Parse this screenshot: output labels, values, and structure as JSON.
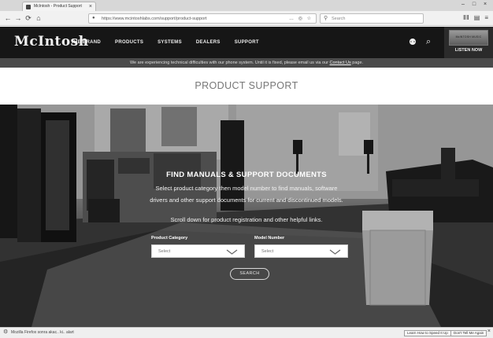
{
  "browser": {
    "tab_title": "McIntosh - Product Support",
    "tab_close": "×",
    "url": "https://www.mcintoshlabs.com/support/product-support",
    "url_actions": "… ◎ ☆",
    "search_placeholder": "Search",
    "nav_icons": [
      "←",
      "→",
      "⟳",
      "⌂"
    ],
    "toolbar_icons": [
      "ⅡⅡ",
      "▤",
      "≡"
    ],
    "window_buttons": [
      "–",
      "□",
      "×"
    ]
  },
  "site": {
    "logo": "McIntosh",
    "nav": [
      {
        "label": "THE BRAND"
      },
      {
        "label": "PRODUCTS"
      },
      {
        "label": "SYSTEMS"
      },
      {
        "label": "DEALERS"
      },
      {
        "label": "SUPPORT"
      }
    ],
    "user_icon": "⚉",
    "search_icon": "⌕",
    "music_badge_image_text": "McINTOSH MUSIC",
    "music_badge_label": "LISTEN NOW"
  },
  "notice": {
    "text": "We are experiencing technical difficulties with our phone system. Until it is fixed, please email us via our",
    "link_text": "Contact Us",
    "suffix": "page."
  },
  "page": {
    "title": "PRODUCT SUPPORT"
  },
  "hero": {
    "heading": "FIND MANUALS & SUPPORT DOCUMENTS",
    "line1": "Select product category then model number to find manuals, software",
    "line2": "drivers and other support documents for current and discontinued models.",
    "line3": "Scroll down for product registration and other helpful links.",
    "category_label": "Product Category",
    "category_value": "Select",
    "model_label": "Model Number",
    "model_value": "Select",
    "search_label": "SEARCH"
  },
  "statusbar": {
    "icon": "⚙",
    "text": "Mozilla Firefox sonra akac.. ki.. alart",
    "button1": "Learn How to Speed It Up",
    "button2": "Don't Tell Me Again",
    "close": "×"
  }
}
